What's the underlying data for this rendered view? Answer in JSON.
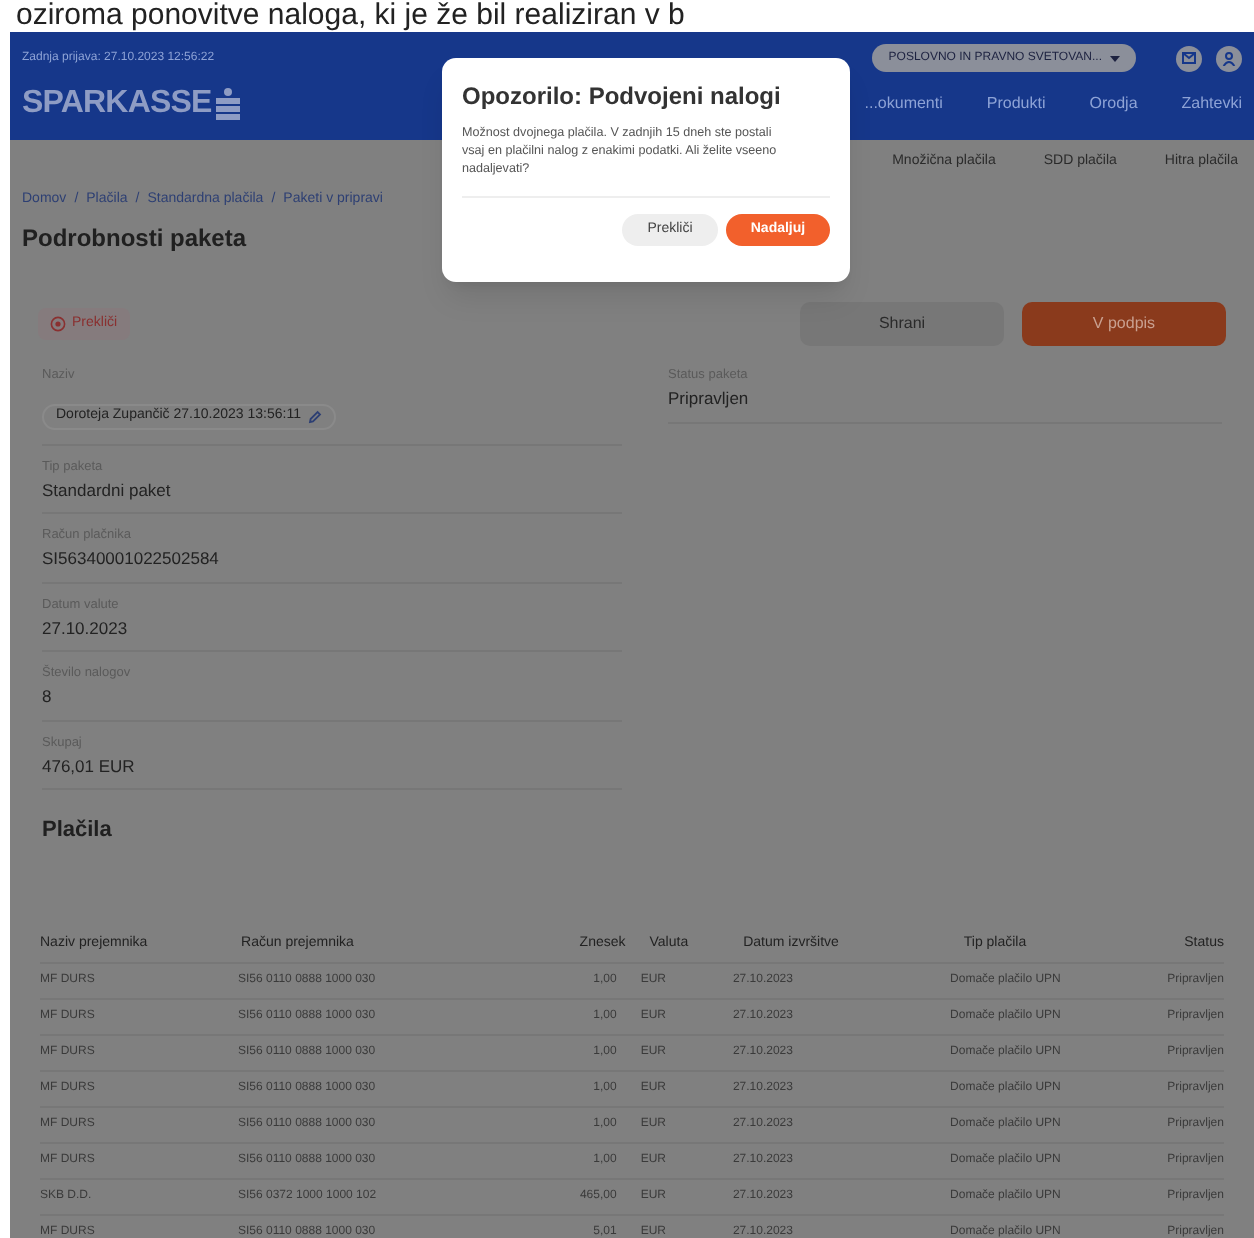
{
  "caption": "oziroma ponovitve naloga, ki je že bil realiziran v b",
  "header": {
    "last_login": "Zadnja prijava: 27.10.2023 12:56:22",
    "account_selector": "POSLOVNO IN PRAVNO SVETOVAN...",
    "logo": "SPARKASSE",
    "nav": [
      "...okumenti",
      "Produkti",
      "Orodja",
      "Zahtevki"
    ],
    "subnav": [
      "Množična plačila",
      "SDD plačila",
      "Hitra plačila"
    ]
  },
  "breadcrumb_separator": "/",
  "breadcrumb": [
    "Domov",
    "Plačila",
    "Standardna plačila",
    "Paketi v pripravi"
  ],
  "title": "Podrobnosti paketa",
  "actions": {
    "cancel": "Prekliči",
    "save": "Shrani",
    "sign": "V podpis"
  },
  "fields": [
    {
      "label": "Naziv",
      "value": "Doroteja Zupančič 27.10.2023 13:56:11",
      "kind": "editable"
    },
    {
      "label": "Tip paketa",
      "value": "Standardni paket",
      "kind": "text"
    },
    {
      "label": "Račun plačnika",
      "value": "SI56340001022502584",
      "kind": "text"
    },
    {
      "label": "Datum valute",
      "value": "27.10.2023",
      "kind": "text"
    },
    {
      "label": "Število nalogov",
      "value": "8",
      "kind": "text"
    },
    {
      "label": "Skupaj",
      "value": "476,01 EUR",
      "kind": "text"
    }
  ],
  "status_field": {
    "label": "Status paketa",
    "value": "Pripravljen"
  },
  "payments": {
    "title": "Plačila",
    "columns": [
      "Naziv prejemnika",
      "Račun prejemnika",
      "Znesek",
      "Valuta",
      "Datum izvršitve",
      "Tip plačila",
      "Status"
    ],
    "rows": [
      [
        "MF DURS",
        "SI56 0110 0888 1000 030",
        "1,00",
        "EUR",
        "27.10.2023",
        "Domače plačilo UPN",
        "Pripravljen"
      ],
      [
        "MF DURS",
        "SI56 0110 0888 1000 030",
        "1,00",
        "EUR",
        "27.10.2023",
        "Domače plačilo UPN",
        "Pripravljen"
      ],
      [
        "MF DURS",
        "SI56 0110 0888 1000 030",
        "1,00",
        "EUR",
        "27.10.2023",
        "Domače plačilo UPN",
        "Pripravljen"
      ],
      [
        "MF DURS",
        "SI56 0110 0888 1000 030",
        "1,00",
        "EUR",
        "27.10.2023",
        "Domače plačilo UPN",
        "Pripravljen"
      ],
      [
        "MF DURS",
        "SI56 0110 0888 1000 030",
        "1,00",
        "EUR",
        "27.10.2023",
        "Domače plačilo UPN",
        "Pripravljen"
      ],
      [
        "MF DURS",
        "SI56 0110 0888 1000 030",
        "1,00",
        "EUR",
        "27.10.2023",
        "Domače plačilo UPN",
        "Pripravljen"
      ],
      [
        "SKB D.D.",
        "SI56 0372 1000 1000 102",
        "465,00",
        "EUR",
        "27.10.2023",
        "Domače plačilo UPN",
        "Pripravljen"
      ],
      [
        "MF DURS",
        "SI56 0110 0888 1000 030",
        "5,01",
        "EUR",
        "27.10.2023",
        "Domače plačilo UPN",
        "Pripravljen"
      ]
    ]
  },
  "dialog": {
    "title": "Opozorilo: Podvojeni nalogi",
    "message": "Možnost dvojnega plačila. V zadnjih 15 dneh ste postali vsaj en plačilni nalog z enakimi podatki. Ali želite vseeno nadaljevati?",
    "cancel": "Prekliči",
    "confirm": "Nadaljuj"
  }
}
